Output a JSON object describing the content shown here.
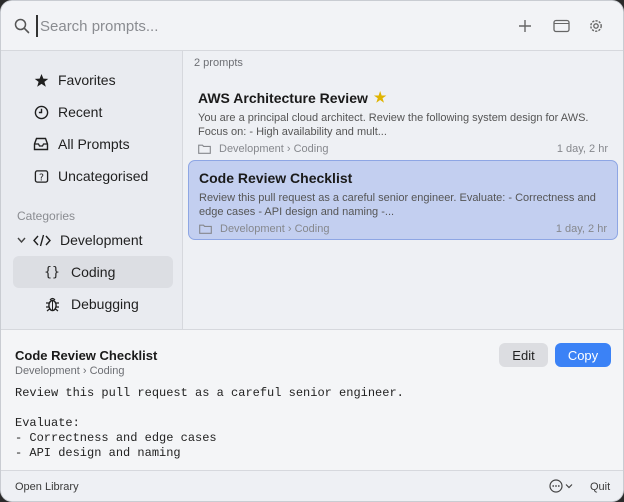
{
  "search": {
    "placeholder": "Search prompts..."
  },
  "toolbar": {
    "add_icon": "plus-icon",
    "window_icon": "window-icon",
    "settings_icon": "gear-icon"
  },
  "sidebar": {
    "items": [
      {
        "label": "Favorites",
        "icon": "star-icon"
      },
      {
        "label": "Recent",
        "icon": "clock-icon"
      },
      {
        "label": "All Prompts",
        "icon": "tray-icon"
      },
      {
        "label": "Uncategorised",
        "icon": "question-box-icon"
      }
    ],
    "categories_heading": "Categories",
    "categories": [
      {
        "label": "Development",
        "icon": "code-icon",
        "expanded": true,
        "children": [
          {
            "label": "Coding",
            "icon": "braces-icon",
            "selected": true
          },
          {
            "label": "Debugging",
            "icon": "bug-icon"
          }
        ]
      }
    ]
  },
  "list": {
    "count_label": "2 prompts",
    "items": [
      {
        "title": "AWS Architecture Review",
        "favorite": true,
        "preview": "You are a principal cloud architect. Review the following system design for AWS. Focus on: - High availability and mult...",
        "path": "Development › Coding",
        "time": "1 day, 2 hr"
      },
      {
        "title": "Code Review Checklist",
        "favorite": false,
        "selected": true,
        "preview": "Review this pull request as a careful senior engineer.  Evaluate: - Correctness and edge cases - API design and naming -...",
        "path": "Development › Coding",
        "time": "1 day, 2 hr"
      }
    ]
  },
  "detail": {
    "title": "Code Review Checklist",
    "path": "Development › Coding",
    "edit_label": "Edit",
    "copy_label": "Copy",
    "content": "Review this pull request as a careful senior engineer.\n\nEvaluate:\n- Correctness and edge cases\n- API design and naming"
  },
  "footer": {
    "open_library_label": "Open Library",
    "quit_label": "Quit"
  },
  "colors": {
    "accent": "#3b82f6",
    "selection": "#c3cff0",
    "star": "#e0b400"
  }
}
